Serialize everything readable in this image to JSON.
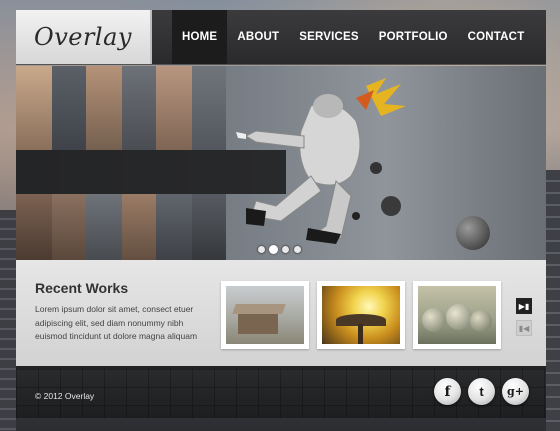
{
  "site": {
    "logo": "Overlay"
  },
  "nav": {
    "items": [
      {
        "label": "HOME",
        "active": true
      },
      {
        "label": "ABOUT",
        "active": false
      },
      {
        "label": "SERVICES",
        "active": false
      },
      {
        "label": "PORTFOLIO",
        "active": false
      },
      {
        "label": "CONTACT",
        "active": false
      }
    ]
  },
  "slider": {
    "slide_count": 4,
    "active_slide": 1
  },
  "works": {
    "title": "Recent Works",
    "description": "Lorem ipsum dolor sit amet, consect etuer adipiscing elit, sed diam nonummy nibh euismod tincidunt ut dolore magna aliquam",
    "thumbnails": [
      {
        "icon": "hut-thumbnail"
      },
      {
        "icon": "mushroom-sunset-thumbnail"
      },
      {
        "icon": "bubbles-thumbnail"
      }
    ],
    "next_icon": "next-arrow-icon",
    "prev_icon": "prev-arrow-icon"
  },
  "footer": {
    "copyright": "© 2012 Overlay",
    "social": [
      {
        "name": "facebook",
        "glyph": "f"
      },
      {
        "name": "twitter",
        "glyph": "t"
      },
      {
        "name": "google-plus",
        "glyph": "g+"
      }
    ]
  },
  "colors": {
    "header_bg": "#2a2a2c",
    "active_nav_bg": "#1c1c1d",
    "works_bg": "#dcdcdc",
    "footer_bg": "#1d1e20"
  }
}
